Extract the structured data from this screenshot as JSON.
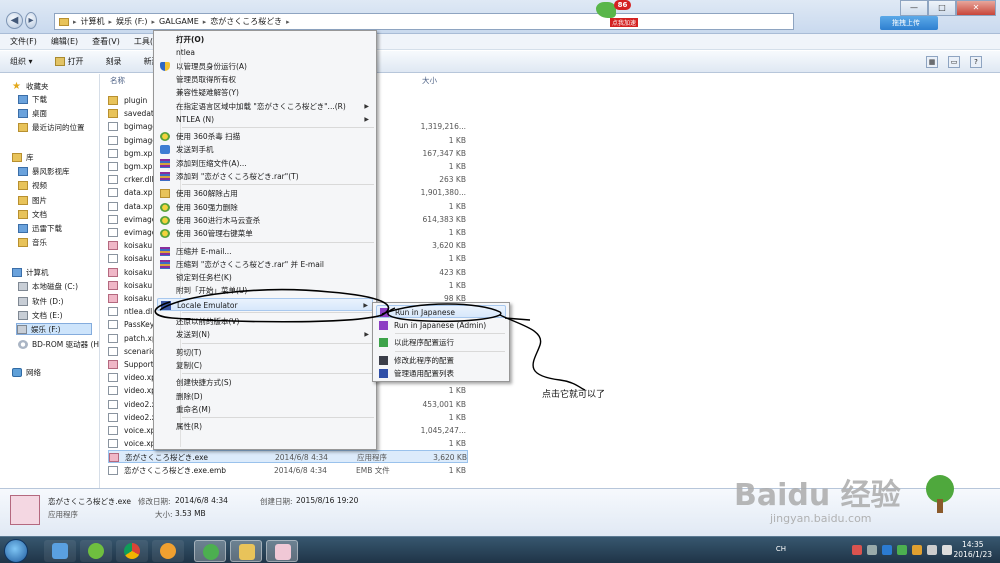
{
  "address": {
    "breadcrumb": [
      "计算机",
      "娱乐 (F:)",
      "GALGAME",
      "恋がさくころ桜どき"
    ],
    "badge_count": "86",
    "badge_label": "点我加速",
    "upload_label": "拖拽上传",
    "win_controls": [
      "—",
      "□",
      "✕"
    ]
  },
  "menubar": {
    "items": [
      "文件(F)",
      "编辑(E)",
      "查看(V)",
      "工具(T)"
    ]
  },
  "toolbar": {
    "items": [
      "组织 ▾",
      "打开",
      "刻录",
      "新建文"
    ]
  },
  "sidebar": {
    "favorites": "收藏夹",
    "fav_items": [
      "下载",
      "桌面",
      "最近访问的位置"
    ],
    "library": "库",
    "lib_items": [
      "暴风影视库",
      "视频",
      "图片",
      "文档",
      "迅雷下载",
      "音乐"
    ],
    "computer": "计算机",
    "drives": [
      "本地磁盘 (C:)",
      "软件 (D:)",
      "文档 (E:)",
      "娱乐 (F:)",
      "BD-ROM 驱动器 (H"
    ],
    "network": "网络"
  },
  "filelist": {
    "col_name": "名称",
    "col_size": "大小",
    "rows": [
      {
        "name": "plugin",
        "date": "",
        "type": "",
        "size": "",
        "kind": "folder"
      },
      {
        "name": "savedata",
        "date": "",
        "type": "",
        "size": "",
        "kind": "folder"
      },
      {
        "name": "bgimage",
        "date": "",
        "type": "",
        "size": "1,319,216...",
        "kind": "file"
      },
      {
        "name": "bgimage",
        "date": "",
        "type": "",
        "size": "1 KB",
        "kind": "file"
      },
      {
        "name": "bgm.xp3",
        "date": "",
        "type": "",
        "size": "167,347 KB",
        "kind": "file"
      },
      {
        "name": "bgm.xp3",
        "date": "",
        "type": "",
        "size": "1 KB",
        "kind": "file"
      },
      {
        "name": "crker.dll",
        "date": "",
        "type": "扩展",
        "size": "263 KB",
        "kind": "file"
      },
      {
        "name": "data.xp3",
        "date": "",
        "type": "",
        "size": "1,901,380...",
        "kind": "file"
      },
      {
        "name": "data.xp3",
        "date": "",
        "type": "",
        "size": "1 KB",
        "kind": "file"
      },
      {
        "name": "evimage",
        "date": "",
        "type": "",
        "size": "614,383 KB",
        "kind": "file"
      },
      {
        "name": "evimage",
        "date": "",
        "type": "",
        "size": "1 KB",
        "kind": "file"
      },
      {
        "name": "koisaku",
        "date": "",
        "type": "",
        "size": "3,620 KB",
        "kind": "app"
      },
      {
        "name": "koisaku",
        "date": "",
        "type": "",
        "size": "1 KB",
        "kind": "file"
      },
      {
        "name": "koisaku",
        "date": "",
        "type": "",
        "size": "423 KB",
        "kind": "app"
      },
      {
        "name": "koisaku",
        "date": "",
        "type": "",
        "size": "1 KB",
        "kind": "app"
      },
      {
        "name": "koisaku",
        "date": "",
        "type": "",
        "size": "98 KB",
        "kind": "app"
      },
      {
        "name": "ntlea.dl",
        "date": "",
        "type": "",
        "size": "",
        "kind": "file"
      },
      {
        "name": "PassKey",
        "date": "",
        "type": "",
        "size": "",
        "kind": "file"
      },
      {
        "name": "patch.xp",
        "date": "",
        "type": "",
        "size": "",
        "kind": "file"
      },
      {
        "name": "scenario",
        "date": "",
        "type": "",
        "size": "",
        "kind": "file"
      },
      {
        "name": "Support",
        "date": "",
        "type": "",
        "size": "",
        "kind": "app"
      },
      {
        "name": "video.xp",
        "date": "",
        "type": "",
        "size": "",
        "kind": "file"
      },
      {
        "name": "video.xp",
        "date": "",
        "type": "",
        "size": "1 KB",
        "kind": "file"
      },
      {
        "name": "video2.x",
        "date": "",
        "type": "",
        "size": "453,001 KB",
        "kind": "file"
      },
      {
        "name": "video2.x",
        "date": "",
        "type": "",
        "size": "1 KB",
        "kind": "file"
      },
      {
        "name": "voice.xp",
        "date": "",
        "type": "",
        "size": "1,045,247...",
        "kind": "file"
      },
      {
        "name": "voice.xp",
        "date": "",
        "type": "",
        "size": "1 KB",
        "kind": "file"
      },
      {
        "name": "恋がさくころ桜どき.exe",
        "date": "2014/6/8 4:34",
        "type": "应用程序",
        "size": "3,620 KB",
        "kind": "app"
      },
      {
        "name": "恋がさくころ桜どき.exe.emb",
        "date": "2014/6/8 4:34",
        "type": "EMB 文件",
        "size": "1 KB",
        "kind": "file"
      }
    ]
  },
  "context_menu": {
    "items": [
      {
        "label": "打开(O)",
        "icon": "",
        "bold": true
      },
      {
        "label": "ntlea",
        "icon": ""
      },
      {
        "label": "以管理员身份运行(A)",
        "icon": "shield"
      },
      {
        "label": "管理员取得所有权",
        "icon": ""
      },
      {
        "label": "兼容性疑难解答(Y)",
        "icon": ""
      },
      {
        "label": "在指定语言区域中加载 \"恋がさくころ桜どき\"...(R)",
        "icon": "",
        "arrow": true
      },
      {
        "label": "NTLEA (N)",
        "icon": "",
        "arrow": true
      },
      {
        "label": "使用 360杀毒 扫描",
        "icon": "360"
      },
      {
        "label": "发送到手机",
        "icon": "phone"
      },
      {
        "label": "添加到压缩文件(A)...",
        "icon": "rar"
      },
      {
        "label": "添加到 \"恋がさくころ桜どき.rar\"(T)",
        "icon": "rar"
      },
      {
        "label": "使用 360解除占用",
        "icon": "fold"
      },
      {
        "label": "使用 360强力删除",
        "icon": "360"
      },
      {
        "label": "使用 360进行木马云查杀",
        "icon": "360"
      },
      {
        "label": "使用 360管理右键菜单",
        "icon": "360"
      },
      {
        "label": "压缩并 E-mail...",
        "icon": "rar"
      },
      {
        "label": "压缩到 \"恋がさくころ桜どき.rar\" 并 E-mail",
        "icon": "rar"
      },
      {
        "label": "锁定到任务栏(K)",
        "icon": ""
      },
      {
        "label": "附到「开始」菜单(U)",
        "icon": ""
      },
      {
        "label": "Locale Emulator",
        "icon": "le",
        "arrow": true,
        "highlight": true
      },
      {
        "label": "还原以前的版本(V)",
        "icon": ""
      },
      {
        "label": "发送到(N)",
        "icon": "",
        "arrow": true
      },
      {
        "label": "剪切(T)",
        "icon": ""
      },
      {
        "label": "复制(C)",
        "icon": ""
      },
      {
        "label": "创建快捷方式(S)",
        "icon": ""
      },
      {
        "label": "删除(D)",
        "icon": ""
      },
      {
        "label": "重命名(M)",
        "icon": ""
      },
      {
        "label": "属性(R)",
        "icon": ""
      }
    ]
  },
  "submenu": {
    "items": [
      {
        "label": "Run in Japanese",
        "icon": "purple",
        "highlight": true
      },
      {
        "label": "Run in Japanese (Admin)",
        "icon": "purple"
      },
      {
        "label": "以此程序配置运行",
        "icon": "green"
      },
      {
        "label": "修改此程序的配置",
        "icon": "dark"
      },
      {
        "label": "管理通用配置列表",
        "icon": "blue"
      }
    ]
  },
  "annotation": "点击它就可以了",
  "details": {
    "filename": "恋がさくころ桜どき.exe",
    "mod_label": "修改日期:",
    "mod_value": "2014/6/8 4:34",
    "created_label": "创建日期:",
    "created_value": "2015/8/16 19:20",
    "type": "应用程序",
    "size_label": "大小:",
    "size_value": "3.53 MB"
  },
  "taskbar": {
    "lang": "CH",
    "time": "14:35",
    "date": "2016/1/23"
  },
  "watermark": {
    "brand": "Baidu 经验",
    "url": "jingyan.baidu.com"
  }
}
